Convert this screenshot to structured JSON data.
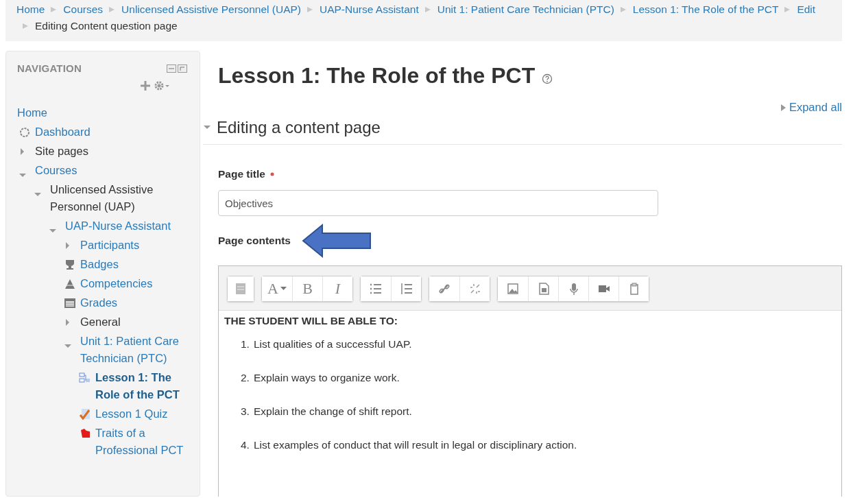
{
  "breadcrumb": [
    {
      "label": "Home",
      "link": true
    },
    {
      "label": "Courses",
      "link": true
    },
    {
      "label": "Unlicensed Assistive Personnel (UAP)",
      "link": true
    },
    {
      "label": "UAP-Nurse Assistant",
      "link": true
    },
    {
      "label": "Unit 1: Patient Care Technician (PTC)",
      "link": true
    },
    {
      "label": "Lesson 1: The Role of the PCT",
      "link": true
    },
    {
      "label": "Edit",
      "link": true
    },
    {
      "label": "Editing Content question page",
      "link": false
    }
  ],
  "navigation": {
    "title": "NAVIGATION",
    "items": [
      {
        "label": "Home",
        "kind": "plain",
        "link": true,
        "selected": false
      },
      {
        "label": "Dashboard",
        "kind": "dashboard",
        "link": true,
        "selected": false
      },
      {
        "label": "Site pages",
        "kind": "branch",
        "expanded": false,
        "link": false,
        "selected": false
      },
      {
        "label": "Courses",
        "kind": "branch",
        "expanded": true,
        "link": true,
        "selected": false,
        "children": [
          {
            "label": "Unlicensed Assistive Personnel (UAP)",
            "kind": "branch",
            "expanded": true,
            "link": false,
            "selected": false,
            "children": [
              {
                "label": "UAP-Nurse Assistant",
                "kind": "branch",
                "expanded": true,
                "link": true,
                "selected": false,
                "children": [
                  {
                    "label": "Participants",
                    "kind": "branch",
                    "expanded": false,
                    "link": true,
                    "selected": false
                  },
                  {
                    "label": "Badges",
                    "kind": "trophy",
                    "link": true,
                    "selected": false
                  },
                  {
                    "label": "Competencies",
                    "kind": "competency",
                    "link": true,
                    "selected": false
                  },
                  {
                    "label": "Grades",
                    "kind": "grades",
                    "link": true,
                    "selected": false
                  },
                  {
                    "label": "General",
                    "kind": "branch",
                    "expanded": false,
                    "link": false,
                    "selected": false
                  },
                  {
                    "label": "Unit 1: Patient Care Technician (PTC)",
                    "kind": "branch",
                    "expanded": true,
                    "link": true,
                    "selected": false,
                    "children": [
                      {
                        "label": "Lesson 1: The Role of the PCT",
                        "kind": "lesson",
                        "link": true,
                        "selected": true
                      },
                      {
                        "label": "Lesson 1 Quiz",
                        "kind": "quiz",
                        "link": true,
                        "selected": false
                      },
                      {
                        "label": "Traits of a Professional PCT",
                        "kind": "page",
                        "link": true,
                        "selected": false
                      }
                    ]
                  }
                ]
              }
            ]
          }
        ]
      }
    ]
  },
  "heading": "Lesson 1: The Role of the PCT",
  "expand_all": "Expand all",
  "section": {
    "title": "Editing a content page",
    "expanded": true
  },
  "page_title": {
    "label": "Page title",
    "required": true,
    "value": "Objectives"
  },
  "page_contents": {
    "label": "Page contents",
    "toolbar": [
      [
        {
          "kind": "collapse"
        }
      ],
      [
        {
          "kind": "style",
          "label": "A"
        },
        {
          "kind": "bold",
          "label": "B"
        },
        {
          "kind": "italic",
          "label": "I"
        }
      ],
      [
        {
          "kind": "bullets"
        },
        {
          "kind": "numbers"
        }
      ],
      [
        {
          "kind": "link"
        },
        {
          "kind": "unlink"
        }
      ],
      [
        {
          "kind": "image"
        },
        {
          "kind": "media"
        },
        {
          "kind": "audio"
        },
        {
          "kind": "video"
        },
        {
          "kind": "paste"
        }
      ]
    ],
    "heading": "THE STUDENT WILL BE ABLE TO:",
    "items": [
      {
        "number": "1.",
        "text": "List qualities of a successful UAP."
      },
      {
        "number": "2.",
        "text": "Explain ways to organize work."
      },
      {
        "number": "3.",
        "text": "Explain the change of shift report."
      },
      {
        "number": "4.",
        "text": "List examples of conduct that will result in legal or disciplinary action."
      }
    ]
  }
}
